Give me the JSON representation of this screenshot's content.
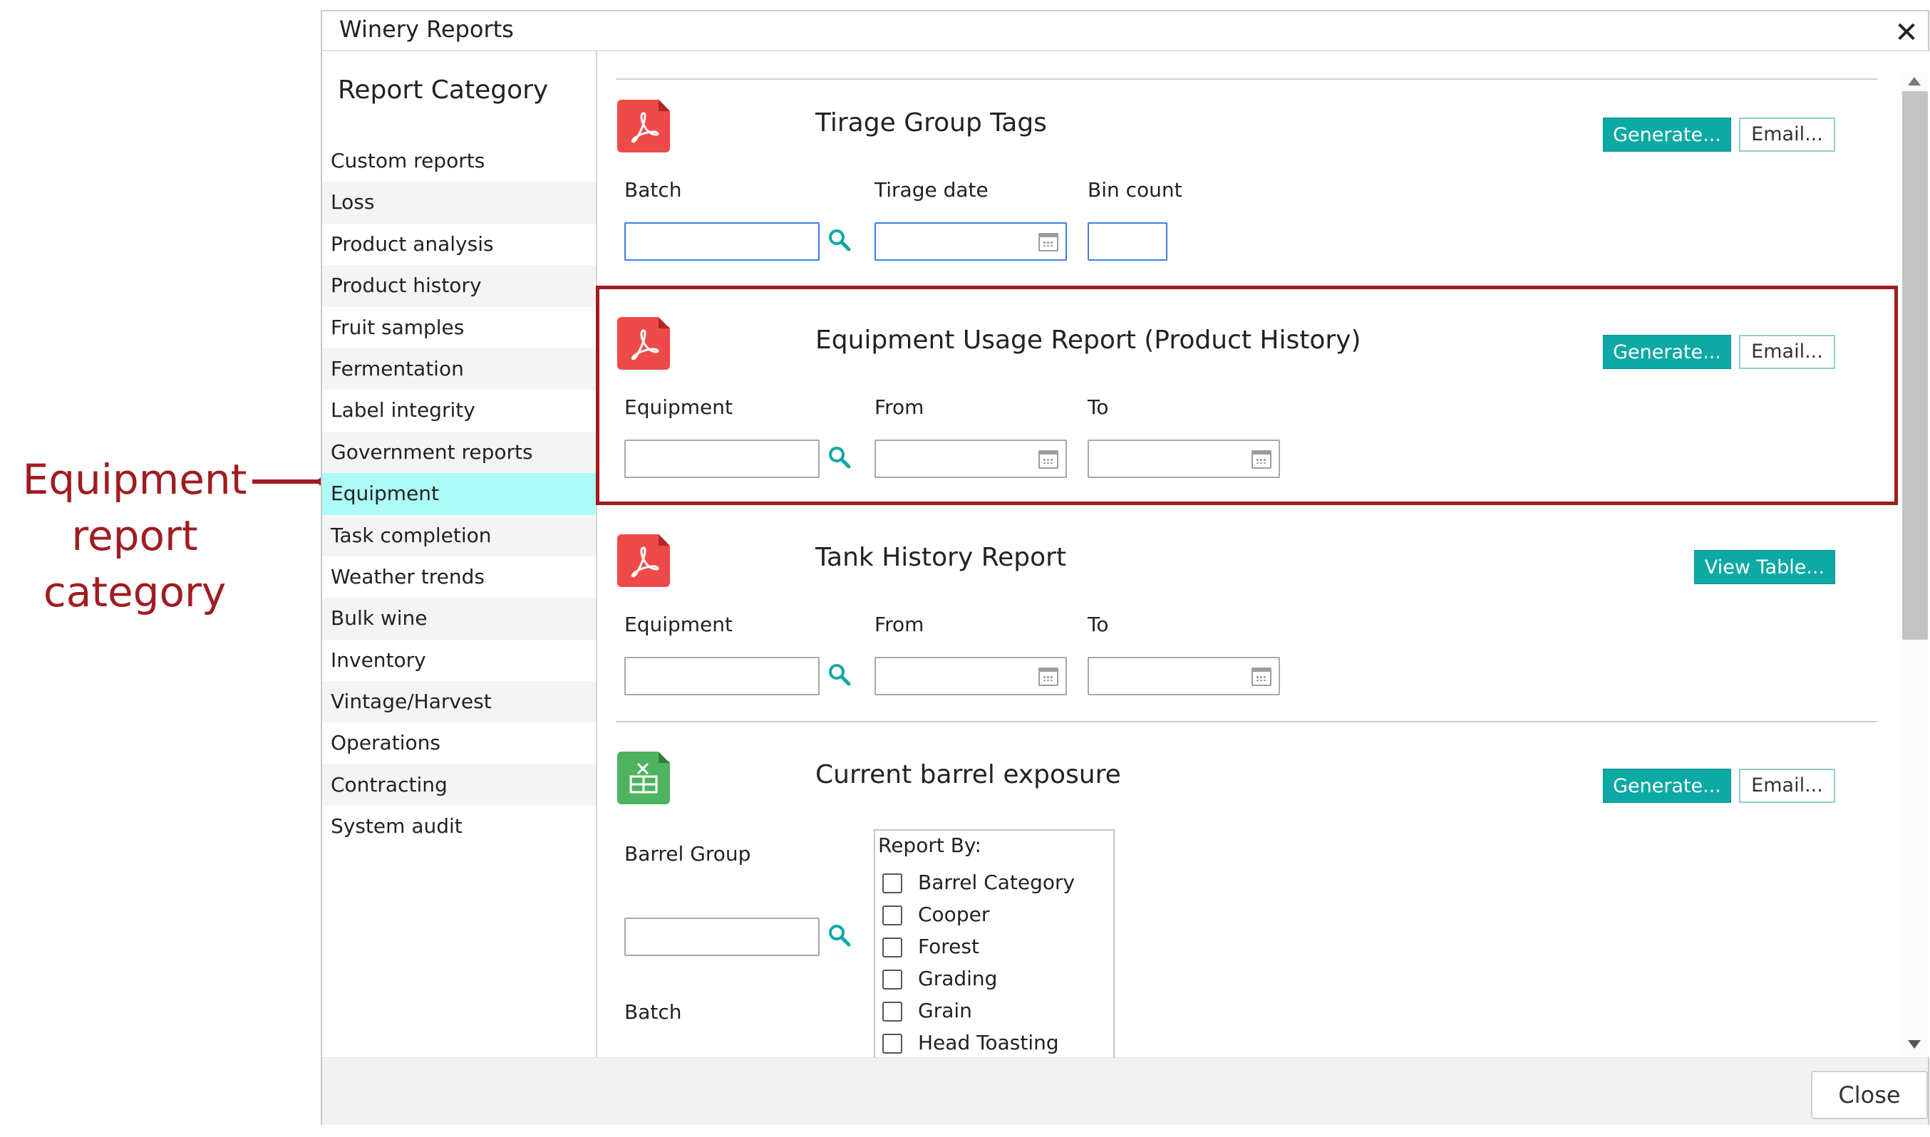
{
  "annotation": {
    "lines": [
      "Equipment",
      "report",
      "category"
    ],
    "color": "#a01c20"
  },
  "dialog": {
    "title": "Winery Reports",
    "close_label": "Close"
  },
  "sidebar": {
    "heading": "Report Category",
    "items": [
      {
        "label": "Custom reports",
        "active": false
      },
      {
        "label": "Loss",
        "active": false
      },
      {
        "label": "Product analysis",
        "active": false
      },
      {
        "label": "Product history",
        "active": false
      },
      {
        "label": "Fruit samples",
        "active": false
      },
      {
        "label": "Fermentation",
        "active": false
      },
      {
        "label": "Label integrity",
        "active": false
      },
      {
        "label": "Government reports",
        "active": false
      },
      {
        "label": "Equipment",
        "active": true
      },
      {
        "label": "Task completion",
        "active": false
      },
      {
        "label": "Weather trends",
        "active": false
      },
      {
        "label": "Bulk wine",
        "active": false
      },
      {
        "label": "Inventory",
        "active": false
      },
      {
        "label": "Vintage/Harvest",
        "active": false
      },
      {
        "label": "Operations",
        "active": false
      },
      {
        "label": "Contracting",
        "active": false
      },
      {
        "label": "System audit",
        "active": false
      }
    ]
  },
  "reports": {
    "tirage": {
      "title": "Tirage Group Tags",
      "icon": "pdf-icon",
      "generate_label": "Generate...",
      "email_label": "Email...",
      "fields": {
        "batch": "Batch",
        "tirage_date": "Tirage date",
        "bin_count": "Bin count"
      }
    },
    "equipment_usage": {
      "title": "Equipment Usage Report (Product History)",
      "icon": "pdf-icon",
      "generate_label": "Generate...",
      "email_label": "Email...",
      "fields": {
        "equipment": "Equipment",
        "from": "From",
        "to": "To"
      }
    },
    "tank_history": {
      "title": "Tank History Report",
      "icon": "pdf-icon",
      "view_table_label": "View Table...",
      "fields": {
        "equipment": "Equipment",
        "from": "From",
        "to": "To"
      }
    },
    "barrel_exposure": {
      "title": "Current barrel exposure",
      "icon": "spreadsheet-icon",
      "generate_label": "Generate...",
      "email_label": "Email...",
      "fields": {
        "barrel_group": "Barrel Group",
        "batch": "Batch"
      },
      "report_by": {
        "title": "Report By:",
        "options": [
          "Barrel Category",
          "Cooper",
          "Forest",
          "Grading",
          "Grain",
          "Head Toasting"
        ]
      }
    }
  },
  "colors": {
    "accent": "#0ca9a5",
    "highlight": "#a01c20",
    "active_category": "#adfcf7",
    "pdf": "#ef4a4a",
    "spreadsheet": "#4db35e"
  }
}
